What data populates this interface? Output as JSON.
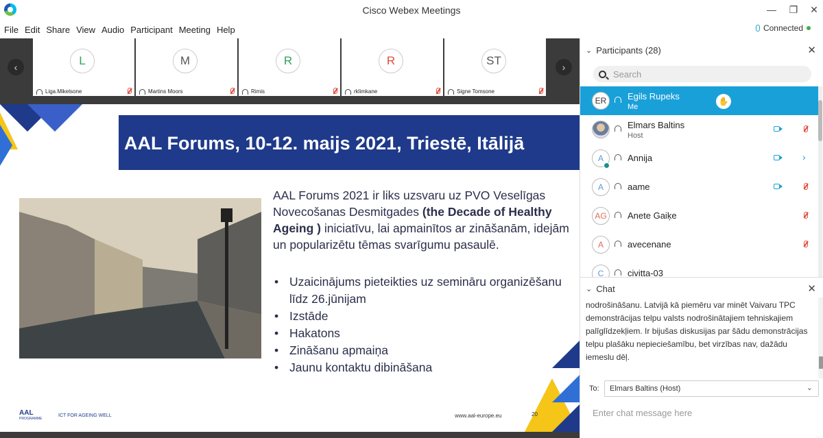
{
  "window": {
    "title": "Cisco Webex Meetings",
    "minimize": "—",
    "restore": "❐",
    "close": "✕"
  },
  "menu": [
    "File",
    "Edit",
    "Share",
    "View",
    "Audio",
    "Participant",
    "Meeting",
    "Help"
  ],
  "connection": {
    "status": "Connected"
  },
  "thumbnails": [
    {
      "initials": "L",
      "name": "Liga.Mikelsone",
      "color": "#2aa35a"
    },
    {
      "initials": "M",
      "name": "Martins Moors",
      "color": "#555555"
    },
    {
      "initials": "R",
      "name": "Rimis",
      "color": "#2aa35a"
    },
    {
      "initials": "R",
      "name": "rklimkane",
      "color": "#e04b3c"
    },
    {
      "initials": "ST",
      "name": "Signe Tomsone",
      "color": "#555555"
    }
  ],
  "slide": {
    "banner_title": "AAL Forums, 10-12. maijs 2021, Triestē, Itālijā",
    "para_start": " AAL Forums 2021 ir liks uzsvaru uz PVO Veselīgas Novecošanas Desmitgades ",
    "para_bold": "(the Decade of Healthy Ageing )",
    "para_end": " iniciatīvu, lai apmainītos ar zināšanām, idejām un popularizētu tēmas svarīgumu pasaulē.",
    "bullets": [
      "Uzaicinājums pieteikties uz semināru organizēšanu līdz 26.jūnijam",
      "Izstāde",
      "Hakatons",
      "Zināšanu apmaiņa",
      "Jaunu kontaktu dibināšana"
    ],
    "footer_logo": "AAL",
    "footer_logo_sub": "PROGRAMME",
    "footer_tagline": "ICT FOR AGEING WELL",
    "footer_url": "www.aal-europe.eu",
    "page_number": "20"
  },
  "participants": {
    "header": "Participants (28)",
    "search_placeholder": "Search",
    "list": [
      {
        "initials": "ER",
        "name": "Egils Rupeks",
        "role": "Me",
        "selected": true,
        "raise_hand": true
      },
      {
        "initials": "",
        "name": "Elmars Baltins",
        "role": "Host",
        "photo": true,
        "video": true,
        "muted": true
      },
      {
        "initials": "A",
        "name": "Annija",
        "role": "",
        "video": true,
        "chevron": true,
        "status_dot": true
      },
      {
        "initials": "A",
        "name": "aame",
        "role": "",
        "video": true,
        "muted": true
      },
      {
        "initials": "AG",
        "name": "Anete Gaiķe",
        "role": "",
        "muted": true,
        "av_color": "#e06b5a"
      },
      {
        "initials": "A",
        "name": "avecenane",
        "role": "",
        "muted": true,
        "av_color": "#e06b5a"
      },
      {
        "initials": "C",
        "name": "civitta-03",
        "role": ""
      }
    ]
  },
  "chat": {
    "header": "Chat",
    "message": "nodrošināšanu. Latvijā kā piemēru var minēt Vaivaru TPC demonstrācijas telpu valsts nodrošinātajiem tehniskajiem palīglīdzekļiem. Ir bijušas diskusijas par šādu demonstrācijas telpu plašāku nepieciešamību, bet virzības nav, dažādu iemeslu dēļ.",
    "to_label": "To:",
    "to_value": "Elmars Baltins (Host)",
    "input_placeholder": "Enter chat message here"
  },
  "colors": {
    "accent": "#1aa0d8",
    "banner": "#1f3a8a",
    "mute": "#e04b3c",
    "slide_yellow": "#f5c518"
  }
}
